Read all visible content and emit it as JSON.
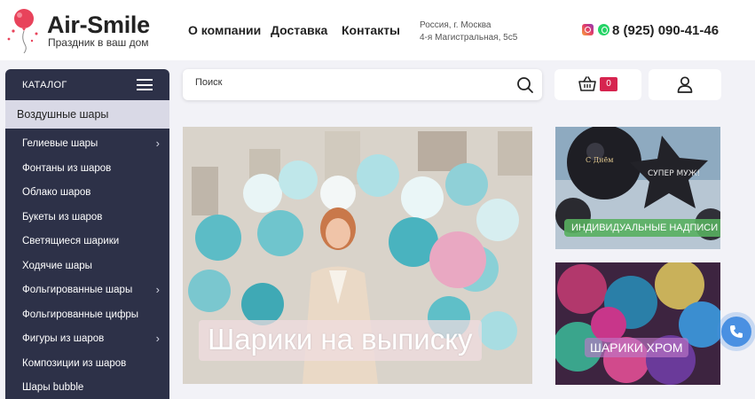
{
  "header": {
    "logo_name": "Air-Smile",
    "logo_tagline": "Праздник в ваш дом",
    "nav": [
      "О компании",
      "Доставка",
      "Контакты"
    ],
    "address_line1": "Россия, г. Москва",
    "address_line2": "4-я Магистральная, 5с5",
    "phone": "8 (925) 090-41-46",
    "social_icons": [
      "instagram-icon",
      "whatsapp-icon"
    ]
  },
  "catalog": {
    "title": "КАТАЛОГ",
    "active_item": "Воздушные шары",
    "items": [
      {
        "label": "Гелиевые шары",
        "has_submenu": true
      },
      {
        "label": "Фонтаны из шаров",
        "has_submenu": false
      },
      {
        "label": "Облако шаров",
        "has_submenu": false
      },
      {
        "label": "Букеты из шаров",
        "has_submenu": false
      },
      {
        "label": "Светящиеся шарики",
        "has_submenu": false
      },
      {
        "label": "Ходячие шары",
        "has_submenu": false
      },
      {
        "label": "Фольгированные шары",
        "has_submenu": true
      },
      {
        "label": "Фольгированные цифры",
        "has_submenu": false
      },
      {
        "label": "Фигуры из шаров",
        "has_submenu": true
      },
      {
        "label": "Композиции из шаров",
        "has_submenu": false
      },
      {
        "label": "Шары bubble",
        "has_submenu": false
      }
    ]
  },
  "search": {
    "placeholder": "Поиск"
  },
  "cart": {
    "count": "0"
  },
  "banners": {
    "hero_caption": "Шарики на выписку",
    "promo1_label": "ИНДИВИДУАЛЬНЫЕ НАДПИСИ",
    "promo2_label": "ШАРИКИ ХРОМ"
  },
  "colors": {
    "sidebar_bg": "#2d3148",
    "accent_red": "#d6244f",
    "call_button": "#4a90e2"
  }
}
